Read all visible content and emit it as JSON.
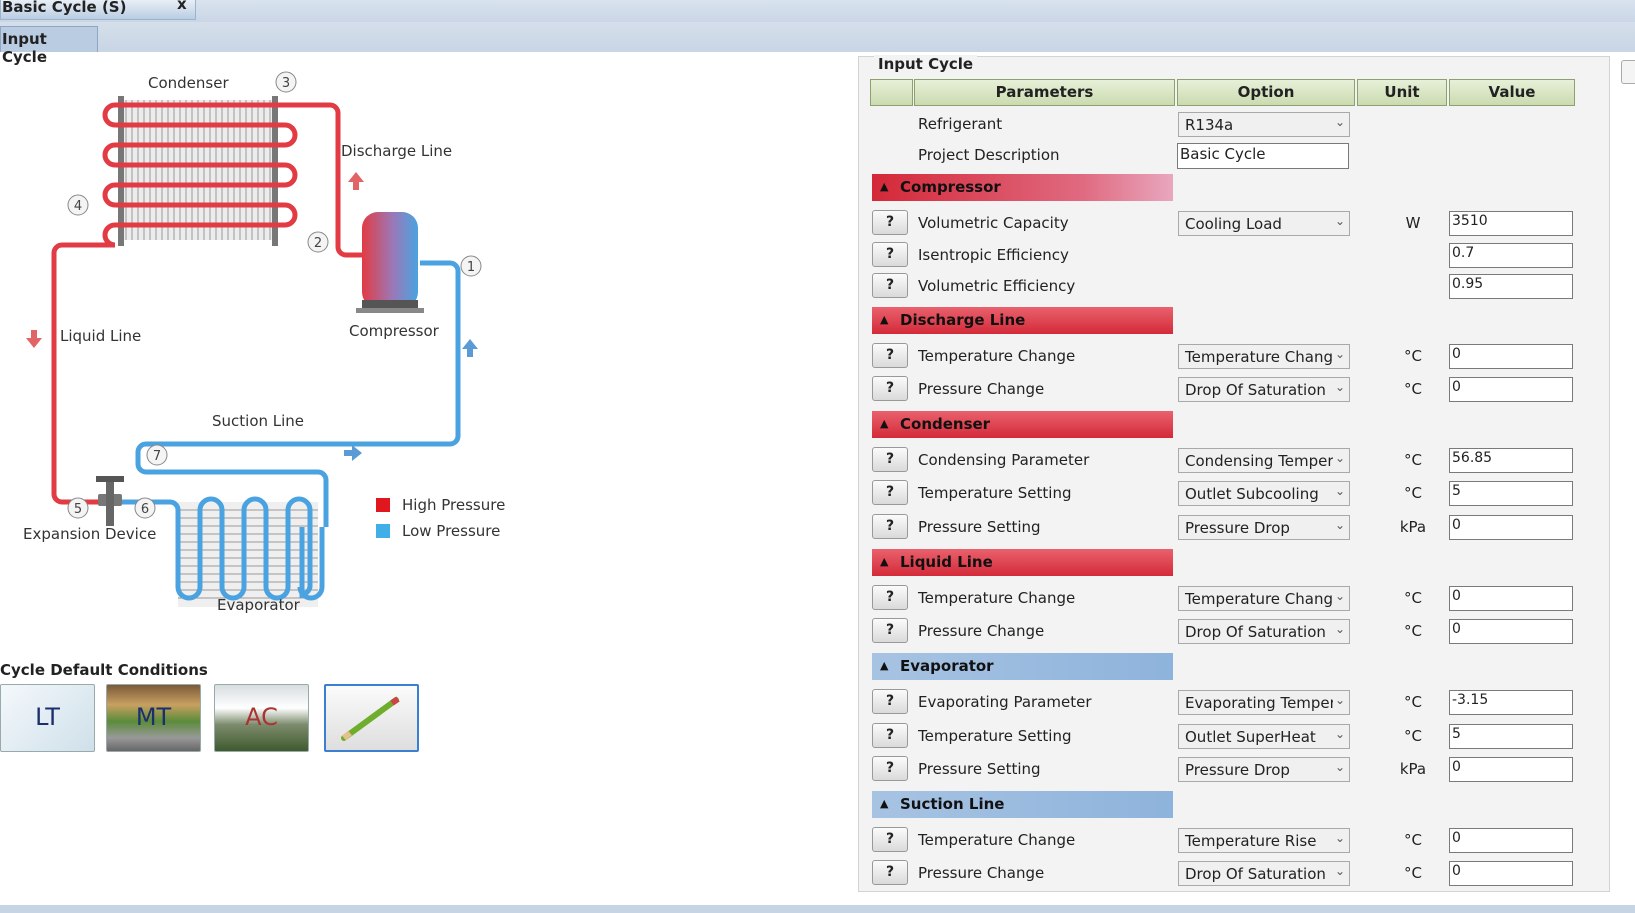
{
  "window": {
    "doc_tab": "Basic Cycle (S)",
    "close_label": "x",
    "sub_tab": "Input Cycle"
  },
  "diagram": {
    "labels": {
      "condenser": "Condenser",
      "discharge_line": "Discharge Line",
      "compressor": "Compressor",
      "liquid_line": "Liquid Line",
      "suction_line": "Suction Line",
      "expansion_device": "Expansion Device",
      "evaporator": "Evaporator"
    },
    "points": [
      "1",
      "2",
      "3",
      "4",
      "5",
      "6",
      "7"
    ],
    "legend": {
      "high": "High Pressure",
      "low": "Low Pressure"
    },
    "colors": {
      "high": "#e23b44",
      "low": "#4aa3e0"
    }
  },
  "cycle_defaults": {
    "title": "Cycle Default Conditions",
    "buttons": [
      {
        "label": "LT",
        "icon": "ice-icon"
      },
      {
        "label": "MT",
        "icon": "market-icon"
      },
      {
        "label": "AC",
        "icon": "house-icon"
      },
      {
        "label": "",
        "icon": "pencil-icon"
      }
    ]
  },
  "panel": {
    "title": "Input Cycle",
    "headers": {
      "parameters": "Parameters",
      "option": "Option",
      "unit": "Unit",
      "value": "Value"
    },
    "refrigerant": {
      "label": "Refrigerant",
      "value": "R134a"
    },
    "project": {
      "label": "Project Description",
      "value": "Basic Cycle"
    },
    "sections": {
      "compressor": {
        "title": "Compressor",
        "rows": [
          {
            "name": "Volumetric Capacity",
            "option": "Cooling Load",
            "unit": "W",
            "value": "3510"
          },
          {
            "name": "Isentropic Efficiency",
            "value": "0.7"
          },
          {
            "name": "Volumetric Efficiency",
            "value": "0.95"
          }
        ]
      },
      "discharge": {
        "title": "Discharge Line",
        "rows": [
          {
            "name": "Temperature Change",
            "option": "Temperature Chang",
            "unit": "°C",
            "value": "0"
          },
          {
            "name": "Pressure Change",
            "option": "Drop Of Saturation ",
            "unit": "°C",
            "value": "0"
          }
        ]
      },
      "condenser": {
        "title": "Condenser",
        "rows": [
          {
            "name": "Condensing Parameter",
            "option": "Condensing Temper",
            "unit": "°C",
            "value": "56.85"
          },
          {
            "name": "Temperature Setting",
            "option": "Outlet Subcooling",
            "unit": "°C",
            "value": "5"
          },
          {
            "name": "Pressure Setting",
            "option": "Pressure Drop",
            "unit": "kPa",
            "value": "0"
          }
        ]
      },
      "liquid": {
        "title": "Liquid Line",
        "rows": [
          {
            "name": "Temperature Change",
            "option": "Temperature Chang",
            "unit": "°C",
            "value": "0"
          },
          {
            "name": "Pressure Change",
            "option": "Drop Of Saturation ",
            "unit": "°C",
            "value": "0"
          }
        ]
      },
      "evaporator": {
        "title": "Evaporator",
        "rows": [
          {
            "name": "Evaporating Parameter",
            "option": "Evaporating Temper",
            "unit": "°C",
            "value": "-3.15"
          },
          {
            "name": "Temperature Setting",
            "option": "Outlet SuperHeat",
            "unit": "°C",
            "value": "5"
          },
          {
            "name": "Pressure Setting",
            "option": "Pressure Drop",
            "unit": "kPa",
            "value": "0"
          }
        ]
      },
      "suction": {
        "title": "Suction Line",
        "rows": [
          {
            "name": "Temperature Change",
            "option": "Temperature Rise",
            "unit": "°C",
            "value": "0"
          },
          {
            "name": "Pressure Change",
            "option": "Drop Of Saturation ",
            "unit": "°C",
            "value": "0"
          }
        ]
      }
    },
    "help_label": "?"
  }
}
